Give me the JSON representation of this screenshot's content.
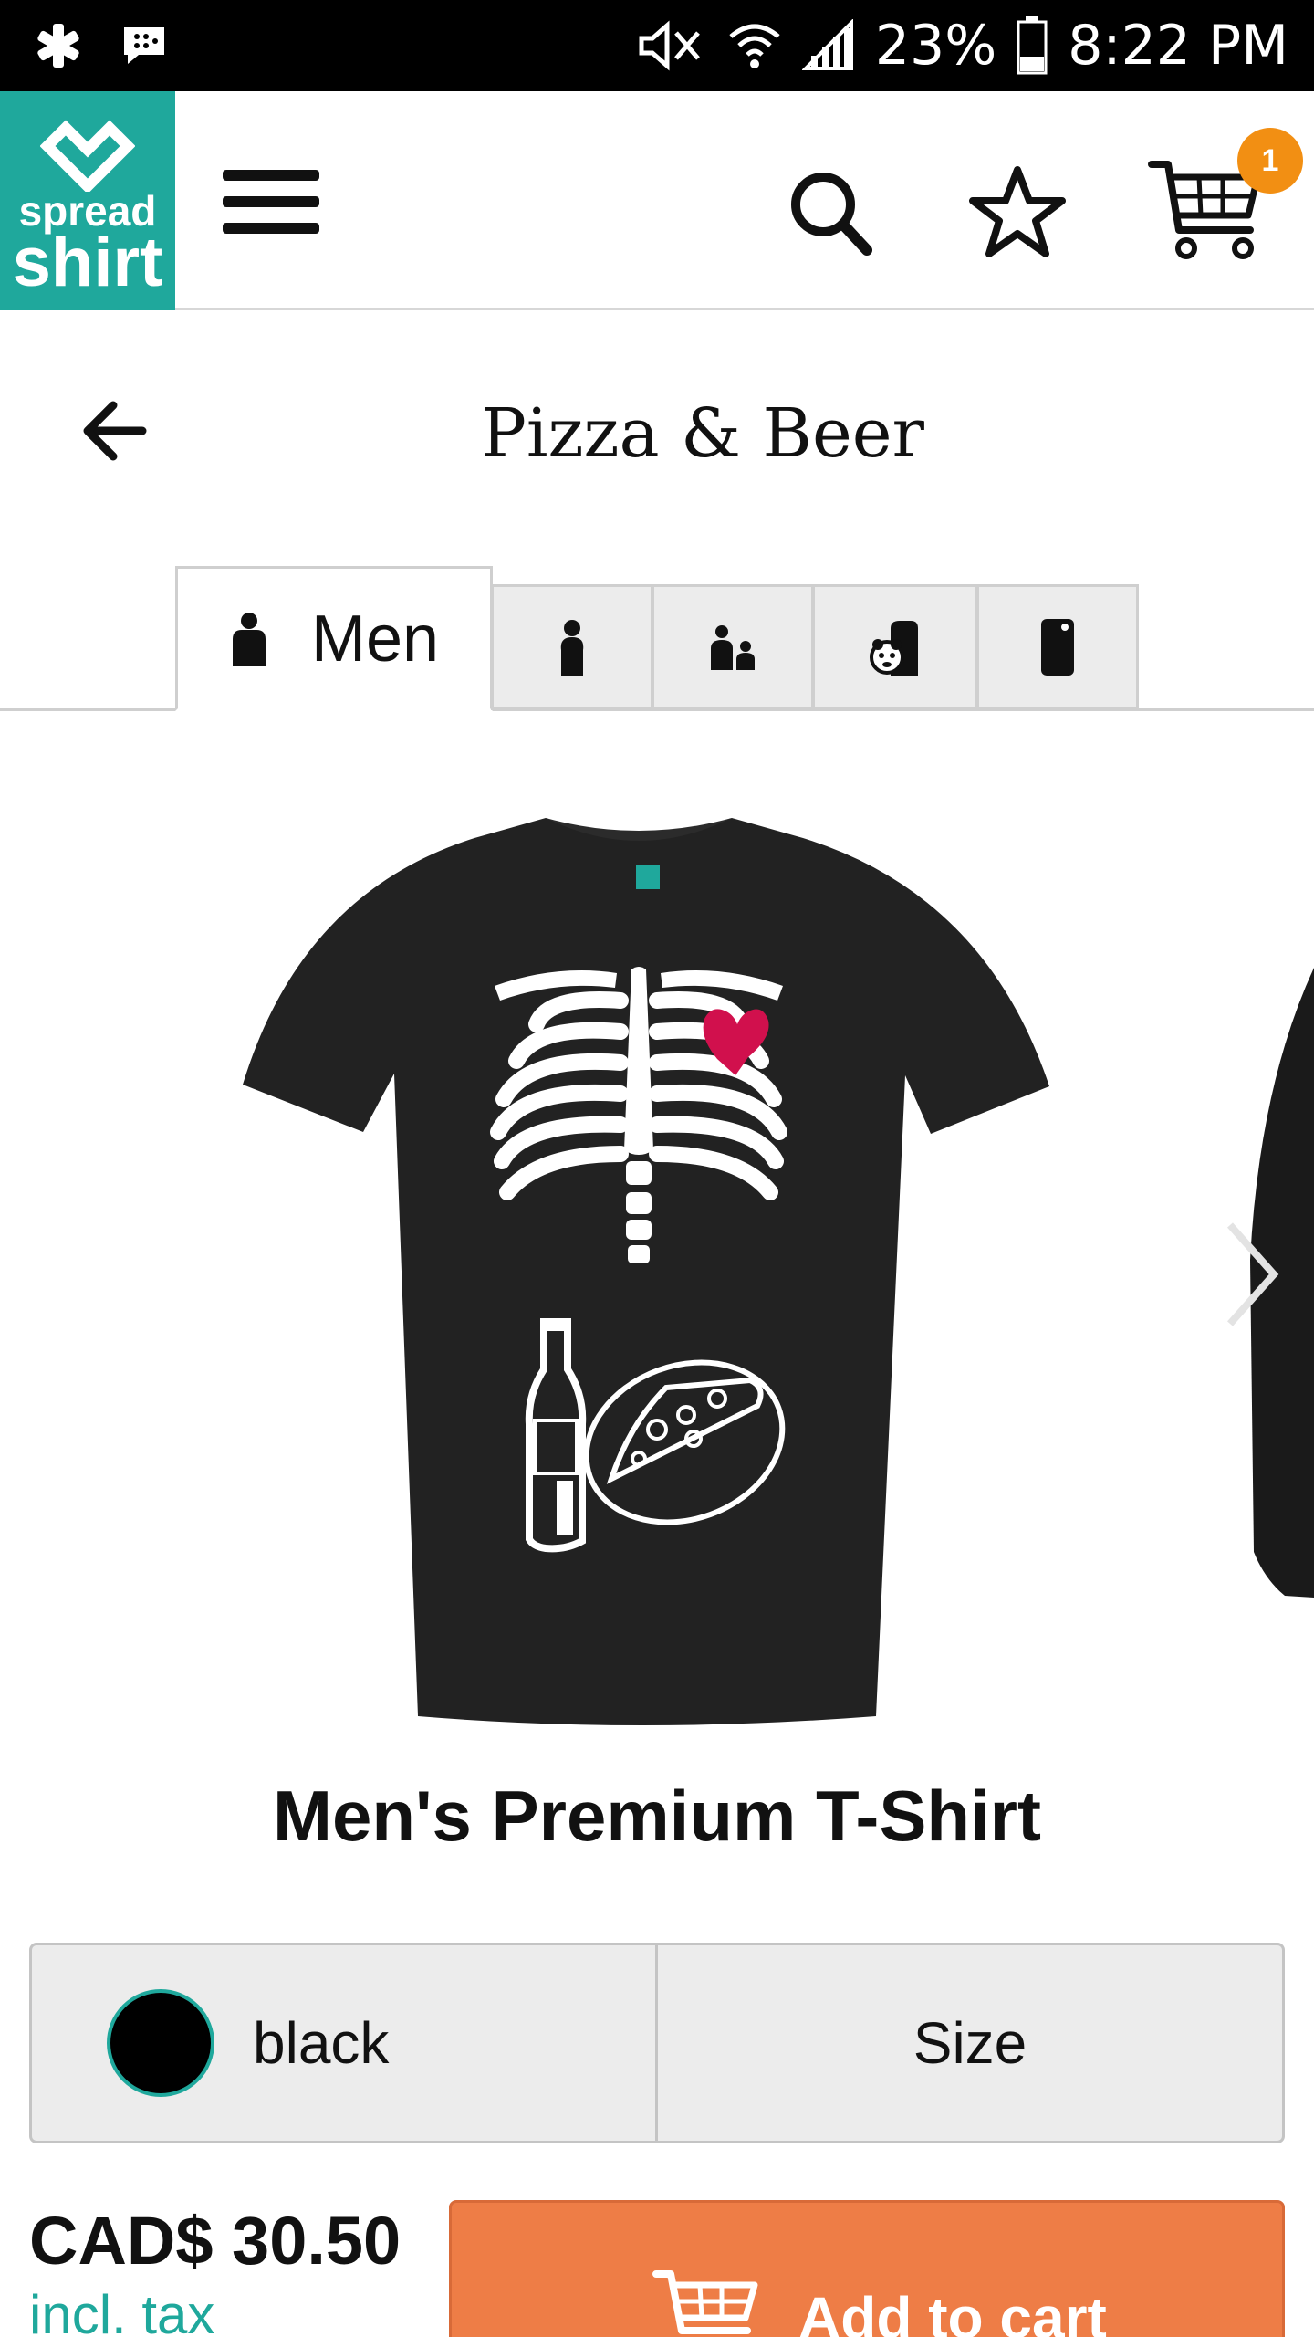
{
  "status_bar": {
    "battery": "23%",
    "time": "8:22 PM"
  },
  "header": {
    "logo_line1": "spread",
    "logo_line2": "shirt",
    "cart_count": "1",
    "brand_color": "#1fa89c",
    "badge_color": "#f28f13"
  },
  "page": {
    "title": "Pizza & Beer"
  },
  "tabs": [
    {
      "label": "Men",
      "icon": "man-icon",
      "active": true
    },
    {
      "label": "",
      "icon": "woman-icon",
      "active": false
    },
    {
      "label": "",
      "icon": "kids-icon",
      "active": false
    },
    {
      "label": "",
      "icon": "baby-icon",
      "active": false
    },
    {
      "label": "",
      "icon": "phone-case-icon",
      "active": false
    }
  ],
  "product": {
    "name": "Men's Premium T-Shirt",
    "color_label": "black",
    "size_label": "Size",
    "price": "CAD$ 30.50",
    "tax_note": "incl. tax",
    "add_to_cart_label": "Add to cart",
    "button_color": "#ee7d46"
  }
}
